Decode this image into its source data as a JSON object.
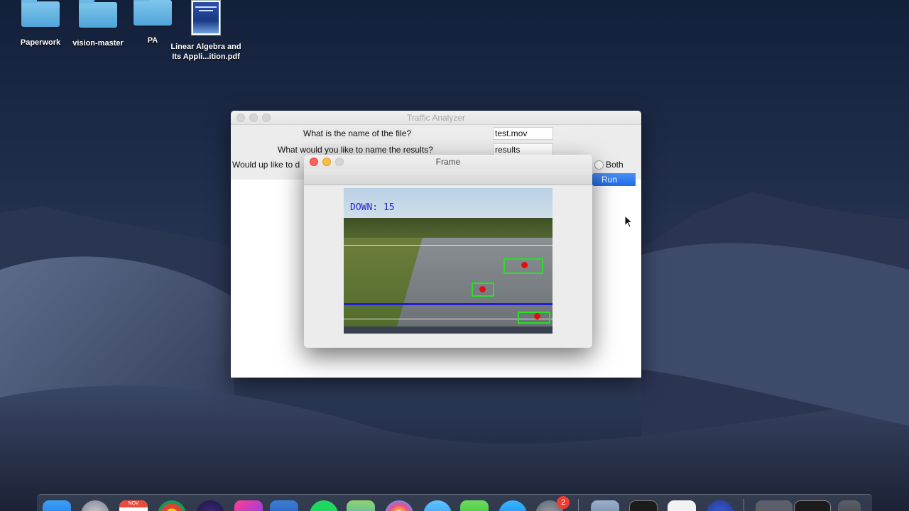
{
  "desktop": {
    "icons": [
      {
        "label": "Paperwork"
      },
      {
        "label": "vision-master"
      },
      {
        "label": "PA"
      },
      {
        "label_line1": "Linear Algebra and",
        "label_line2": "Its Appli...ition.pdf"
      }
    ]
  },
  "traffic_analyzer": {
    "title": "Traffic Analyzer",
    "file_question": "What is the name of the file?",
    "file_value": "test.mov",
    "results_question": "What would you like to name the results?",
    "results_value": "results",
    "mode_question_partial": "Would up like to d",
    "radio_both_label": "Both",
    "run_label": "Run"
  },
  "frame_window": {
    "title": "Frame",
    "counter_label": "DOWN: 15"
  },
  "dock": {
    "calendar_month": "NOV",
    "badge_count": "2"
  },
  "colors": {
    "accent_blue": "#1f6de8",
    "detection_green": "#27e027",
    "centroid_red": "#e01010",
    "count_line_blue": "#2424cc"
  }
}
